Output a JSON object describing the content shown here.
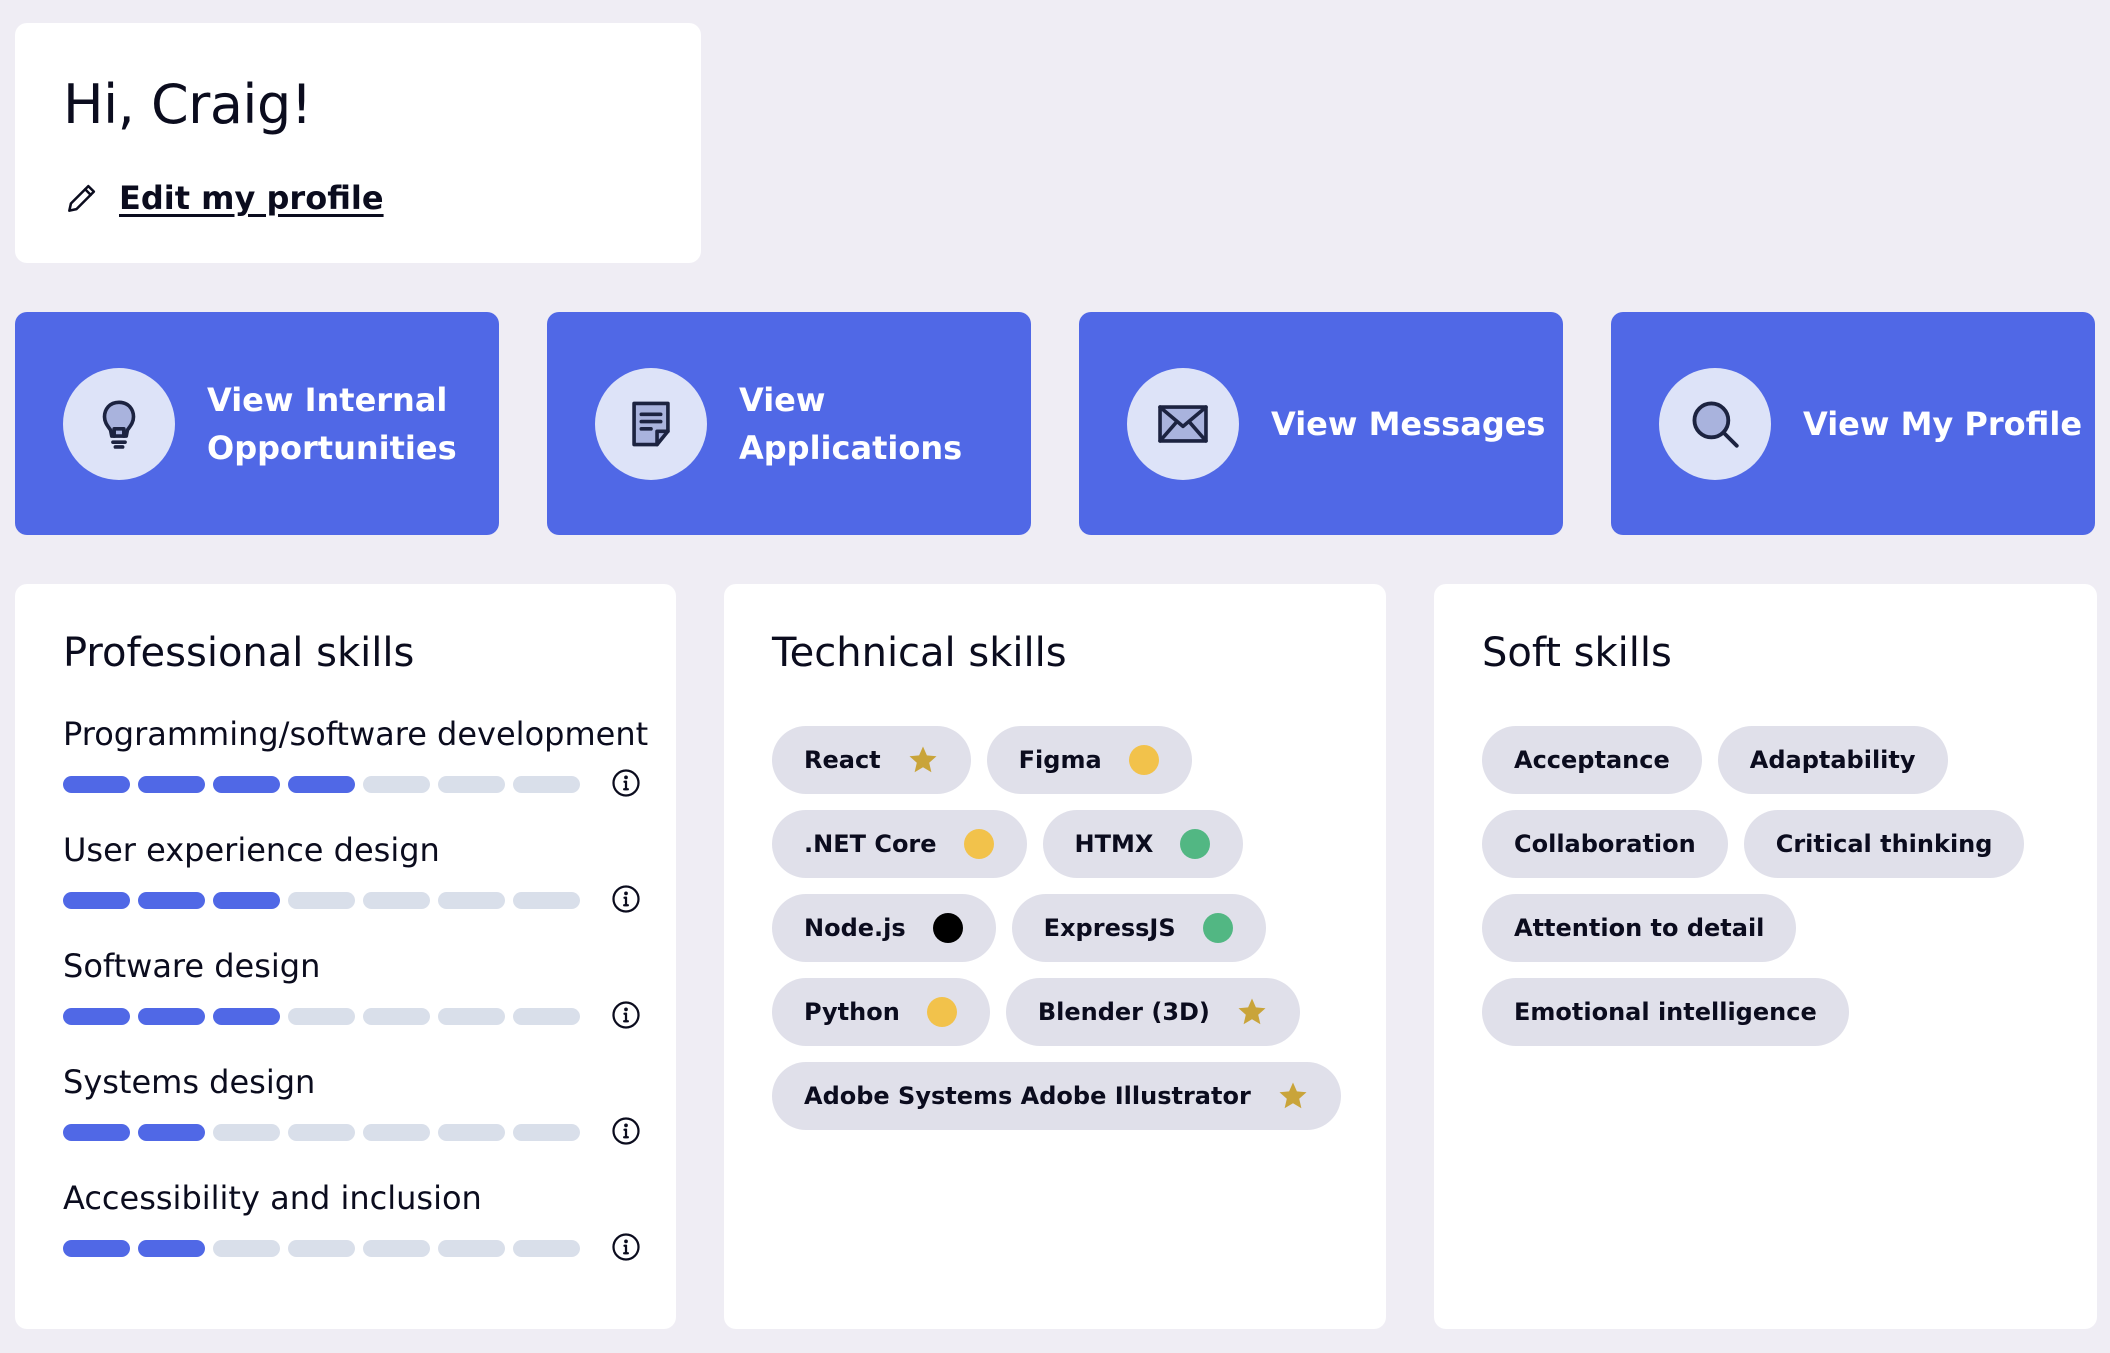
{
  "greeting": {
    "title": "Hi, Craig!",
    "edit_link_label": "Edit my profile",
    "edit_icon": "pencil-icon"
  },
  "actions": [
    {
      "line1": "View Internal",
      "line2": "Opportunities",
      "icon": "lightbulb-icon"
    },
    {
      "line1": "View",
      "line2": "Applications",
      "icon": "document-icon"
    },
    {
      "line1": "View Messages",
      "line2": "",
      "icon": "envelope-icon"
    },
    {
      "line1": "View My Profile",
      "line2": "",
      "icon": "magnifier-icon"
    }
  ],
  "professional_skills": {
    "title": "Professional skills",
    "scale_max": 7,
    "items": [
      {
        "name": "Programming/software development",
        "level": 4
      },
      {
        "name": "User experience design",
        "level": 3
      },
      {
        "name": "Software design",
        "level": 3
      },
      {
        "name": "Systems design",
        "level": 2
      },
      {
        "name": "Accessibility and inclusion",
        "level": 2
      }
    ]
  },
  "technical_skills": {
    "title": "Technical skills",
    "items": [
      {
        "name": "React",
        "marker": "star",
        "color": "#c9a43a"
      },
      {
        "name": "Figma",
        "marker": "dot",
        "color": "#f2c24b"
      },
      {
        "name": ".NET Core",
        "marker": "dot",
        "color": "#f2c24b"
      },
      {
        "name": "HTMX",
        "marker": "dot",
        "color": "#52b783"
      },
      {
        "name": "Node.js",
        "marker": "dot",
        "color": "#000000"
      },
      {
        "name": "ExpressJS",
        "marker": "dot",
        "color": "#52b783"
      },
      {
        "name": "Python",
        "marker": "dot",
        "color": "#f2c24b"
      },
      {
        "name": "Blender (3D)",
        "marker": "star",
        "color": "#c9a43a"
      },
      {
        "name": "Adobe Systems Adobe Illustrator",
        "marker": "star",
        "color": "#c9a43a"
      }
    ]
  },
  "soft_skills": {
    "title": "Soft skills",
    "items": [
      "Acceptance",
      "Adaptability",
      "Collaboration",
      "Critical thinking",
      "Attention to detail",
      "Emotional intelligence"
    ]
  },
  "colors": {
    "accent": "#5068e6",
    "background": "#efedf4",
    "tag_background": "#e0e0ea",
    "bar_empty": "#d9dfea"
  }
}
